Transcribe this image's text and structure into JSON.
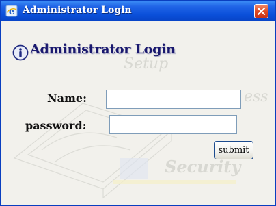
{
  "window": {
    "title": "Administrator Login",
    "close_icon": "close-icon"
  },
  "form": {
    "heading": "Administrator Login",
    "name_label": "Name:",
    "name_value": "",
    "password_label": "password:",
    "password_value": "",
    "submit_label": "submit"
  },
  "background": {
    "words": [
      "Setup",
      "ess",
      "Security"
    ]
  },
  "colors": {
    "titlebar": "#0a4fd9",
    "close_button": "#df4a22",
    "heading": "#19186e",
    "field_border": "#7f9db9"
  }
}
